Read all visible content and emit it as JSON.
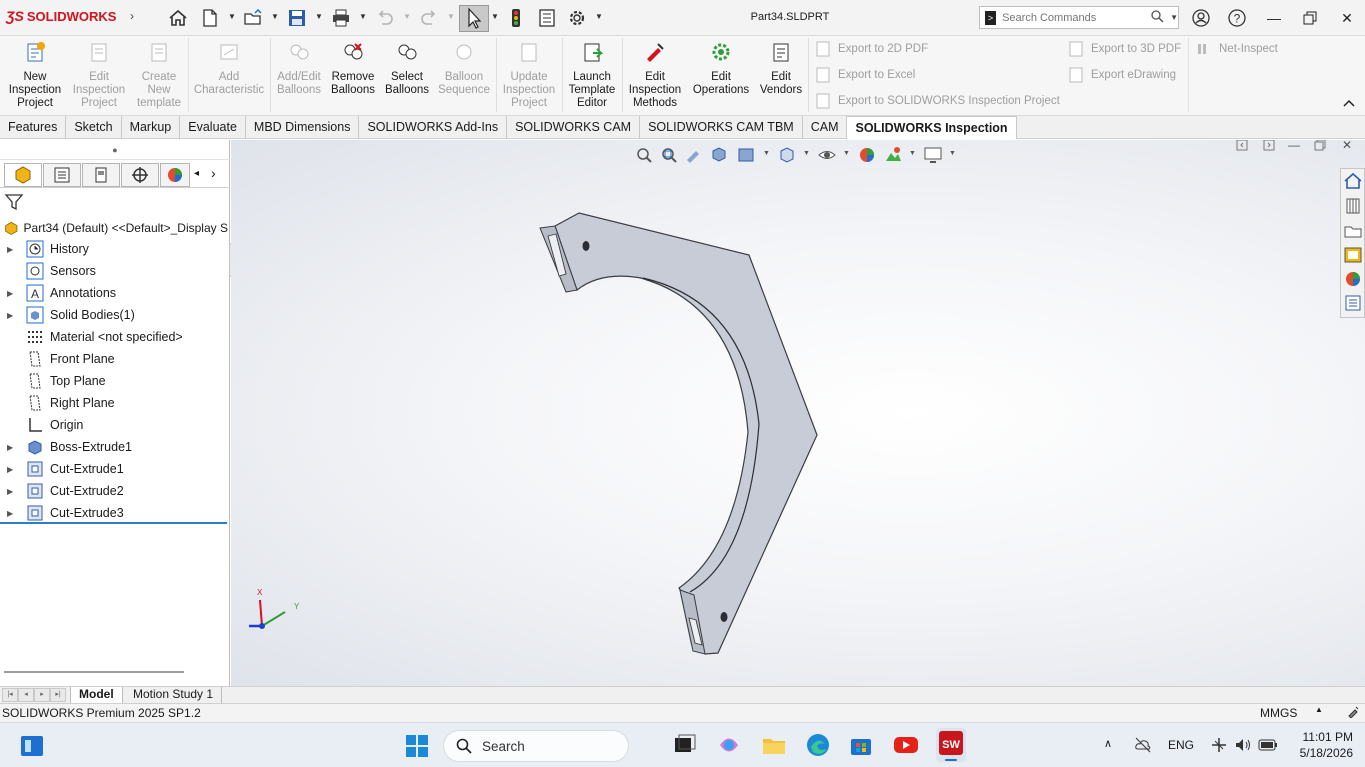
{
  "app": {
    "brand": "SOLIDWORKS",
    "document_title": "Part34.SLDPRT"
  },
  "search": {
    "placeholder": "Search Commands"
  },
  "ribbon": {
    "buttons": [
      {
        "label": "New Inspection Project",
        "lines": [
          "New",
          "Inspection",
          "Project"
        ],
        "enabled": true
      },
      {
        "label": "Edit Inspection Project",
        "lines": [
          "Edit",
          "Inspection",
          "Project"
        ],
        "enabled": false
      },
      {
        "label": "Create New template",
        "lines": [
          "Create",
          "New",
          "template"
        ],
        "enabled": false
      },
      {
        "label": "Add Characteristic",
        "lines": [
          "Add",
          "Characteristic"
        ],
        "enabled": false
      },
      {
        "label": "Add/Edit Balloons",
        "lines": [
          "Add/Edit",
          "Balloons"
        ],
        "enabled": false
      },
      {
        "label": "Remove Balloons",
        "lines": [
          "Remove",
          "Balloons"
        ],
        "enabled": true
      },
      {
        "label": "Select Balloons",
        "lines": [
          "Select",
          "Balloons"
        ],
        "enabled": true
      },
      {
        "label": "Balloon Sequence",
        "lines": [
          "Balloon",
          "Sequence"
        ],
        "enabled": false
      },
      {
        "label": "Update Inspection Project",
        "lines": [
          "Update",
          "Inspection",
          "Project"
        ],
        "enabled": false
      },
      {
        "label": "Launch Template Editor",
        "lines": [
          "Launch",
          "Template",
          "Editor"
        ],
        "enabled": true
      },
      {
        "label": "Edit Inspection Methods",
        "lines": [
          "Edit",
          "Inspection",
          "Methods"
        ],
        "enabled": true
      },
      {
        "label": "Edit Operations",
        "lines": [
          "Edit",
          "Operations"
        ],
        "enabled": true
      },
      {
        "label": "Edit Vendors",
        "lines": [
          "Edit",
          "Vendors"
        ],
        "enabled": true
      }
    ],
    "export": {
      "pdf2d": "Export to 2D PDF",
      "excel": "Export to Excel",
      "project": "Export to SOLIDWORKS Inspection Project",
      "pdf3d": "Export to 3D PDF",
      "edrawing": "Export eDrawing",
      "net": "Net-Inspect"
    }
  },
  "tabs": [
    "Features",
    "Sketch",
    "Markup",
    "Evaluate",
    "MBD Dimensions",
    "SOLIDWORKS Add-Ins",
    "SOLIDWORKS CAM",
    "SOLIDWORKS CAM TBM",
    "CAM",
    "SOLIDWORKS Inspection"
  ],
  "active_tab": "SOLIDWORKS Inspection",
  "feature_tree": {
    "root": "Part34 (Default) <<Default>_Display S",
    "items": [
      {
        "label": "History",
        "expandable": true,
        "icon": "history-icon"
      },
      {
        "label": "Sensors",
        "expandable": false,
        "icon": "sensors-icon"
      },
      {
        "label": "Annotations",
        "expandable": true,
        "icon": "annotations-icon"
      },
      {
        "label": "Solid Bodies(1)",
        "expandable": true,
        "icon": "solid-bodies-icon"
      },
      {
        "label": "Material <not specified>",
        "expandable": false,
        "icon": "material-icon"
      },
      {
        "label": "Front Plane",
        "expandable": false,
        "icon": "plane-icon"
      },
      {
        "label": "Top Plane",
        "expandable": false,
        "icon": "plane-icon"
      },
      {
        "label": "Right Plane",
        "expandable": false,
        "icon": "plane-icon"
      },
      {
        "label": "Origin",
        "expandable": false,
        "icon": "origin-icon"
      },
      {
        "label": "Boss-Extrude1",
        "expandable": true,
        "icon": "boss-extrude-icon"
      },
      {
        "label": "Cut-Extrude1",
        "expandable": true,
        "icon": "cut-extrude-icon"
      },
      {
        "label": "Cut-Extrude2",
        "expandable": true,
        "icon": "cut-extrude-icon"
      },
      {
        "label": "Cut-Extrude3",
        "expandable": true,
        "icon": "cut-extrude-icon"
      }
    ]
  },
  "triad": {
    "x": "X",
    "y": "Y"
  },
  "bottom_tabs": [
    "Model",
    "Motion Study 1"
  ],
  "status": {
    "version": "SOLIDWORKS Premium 2025 SP1.2",
    "units": "MMGS"
  },
  "taskbar": {
    "search_label": "Search",
    "language": "ENG",
    "time": "11:01 PM",
    "date": "5/18/2026"
  },
  "colors": {
    "accent": "#2b7cd3",
    "brand_red": "#d4121c",
    "part_face": "#c9cdd8",
    "part_side": "#6b6e78"
  }
}
